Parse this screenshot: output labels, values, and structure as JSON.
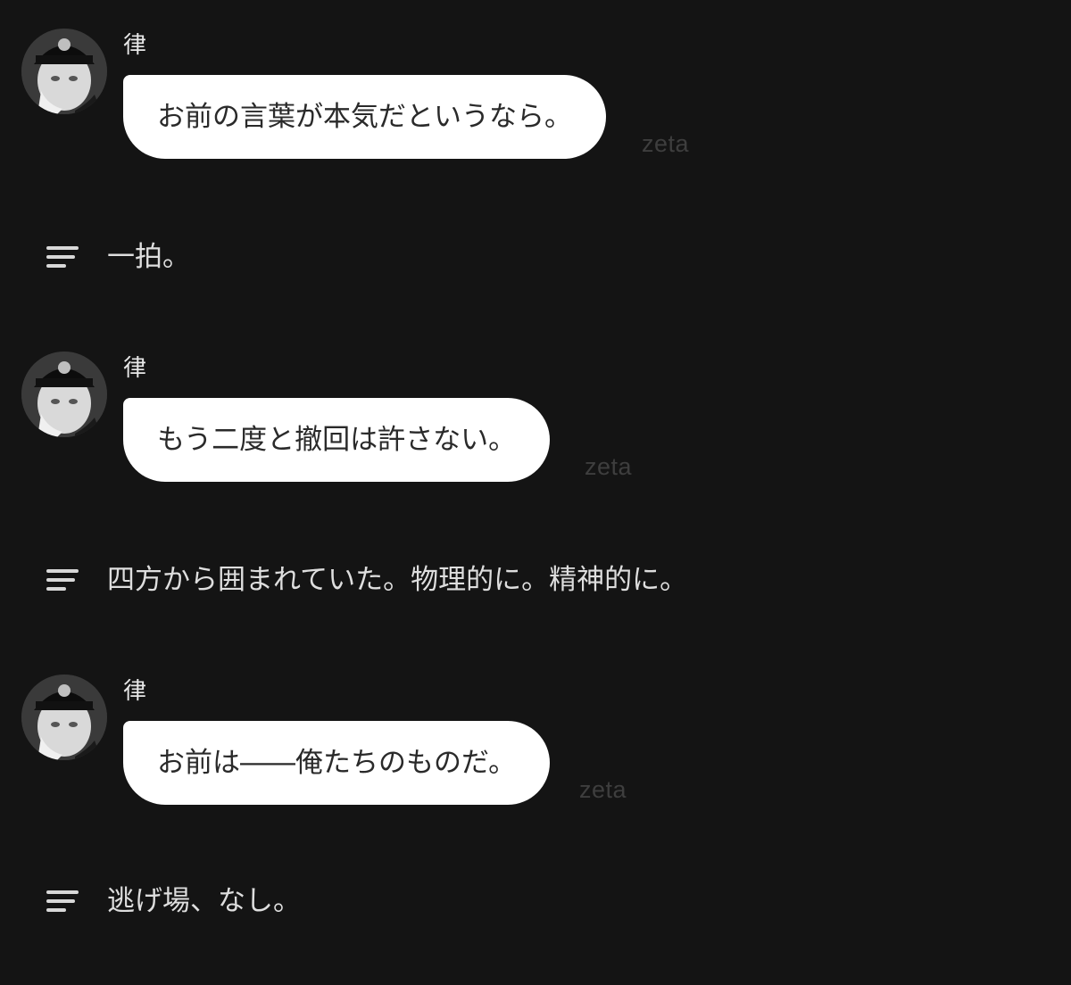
{
  "messages": [
    {
      "name": "律",
      "text": "お前の言葉が本気だというなら。",
      "tag": "zeta"
    },
    {
      "name": "律",
      "text": "もう二度と撤回は許さない。",
      "tag": "zeta"
    },
    {
      "name": "律",
      "text": "お前は――俺たちのものだ。",
      "tag": "zeta"
    }
  ],
  "narrations": [
    {
      "icon": "text-lines-icon",
      "text": "一拍。"
    },
    {
      "icon": "text-lines-icon",
      "text": "四方から囲まれていた。物理的に。精神的に。"
    },
    {
      "icon": "text-lines-icon",
      "text": "逃げ場、なし。"
    }
  ],
  "colors": {
    "background": "#141414",
    "bubble": "#ffffff",
    "bubble_text": "#2a2a2a",
    "tag": "#3e3e3e"
  }
}
